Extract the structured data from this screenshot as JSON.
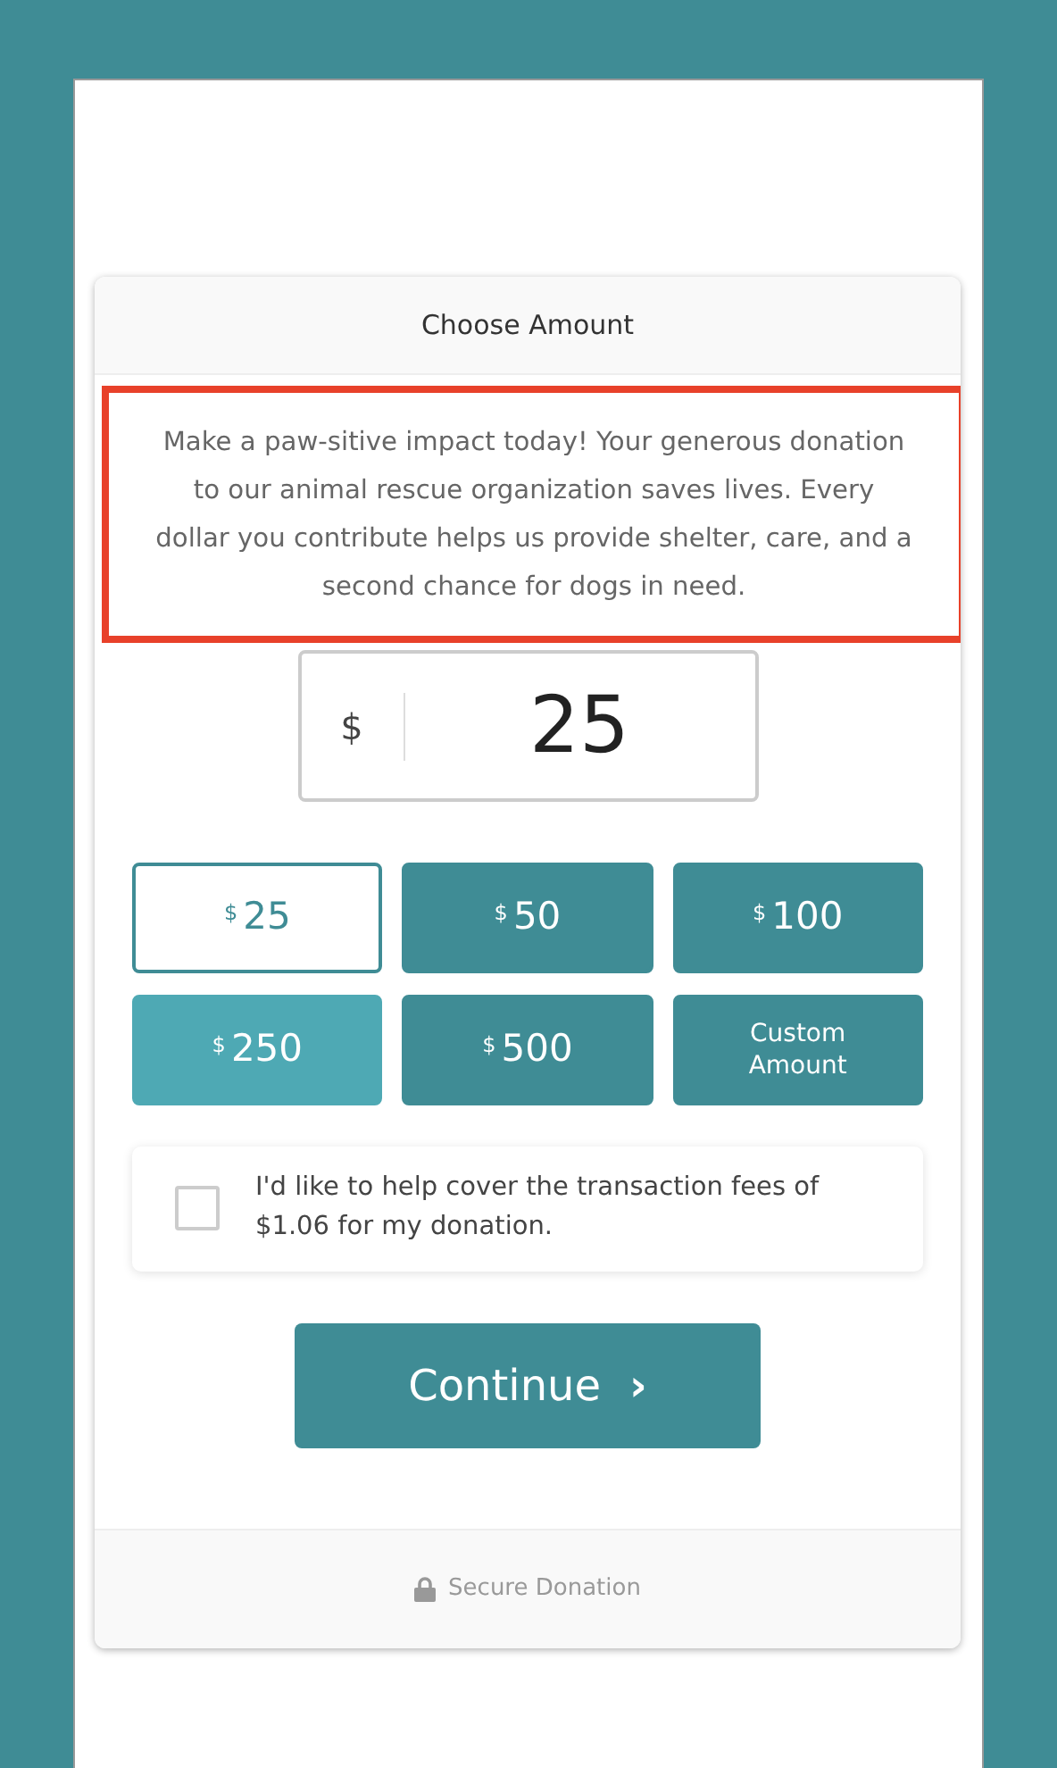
{
  "card_header": {
    "title": "Choose Amount"
  },
  "description": {
    "text": "Make a paw-sitive impact today! Your generous donation to our animal rescue organization saves lives. Every dollar you contribute helps us provide shelter, care, and a second chance for dogs in need.",
    "highlighted": true
  },
  "amount_field": {
    "currency": "$",
    "value": "25"
  },
  "amount_options": [
    {
      "kind": "preset",
      "currency": "$",
      "amount": "25",
      "selected": true,
      "hovered": false
    },
    {
      "kind": "preset",
      "currency": "$",
      "amount": "50",
      "selected": false,
      "hovered": false
    },
    {
      "kind": "preset",
      "currency": "$",
      "amount": "100",
      "selected": false,
      "hovered": false
    },
    {
      "kind": "preset",
      "currency": "$",
      "amount": "250",
      "selected": false,
      "hovered": true
    },
    {
      "kind": "preset",
      "currency": "$",
      "amount": "500",
      "selected": false,
      "hovered": false
    },
    {
      "kind": "custom",
      "label": "Custom Amount",
      "selected": false,
      "hovered": false
    }
  ],
  "fee_option": {
    "label": "I'd like to help cover the transaction fees of $1.06 for my donation.",
    "checked": false
  },
  "continue_button": {
    "label": "Continue",
    "arrow": "›"
  },
  "footer": {
    "text": "Secure Donation"
  }
}
